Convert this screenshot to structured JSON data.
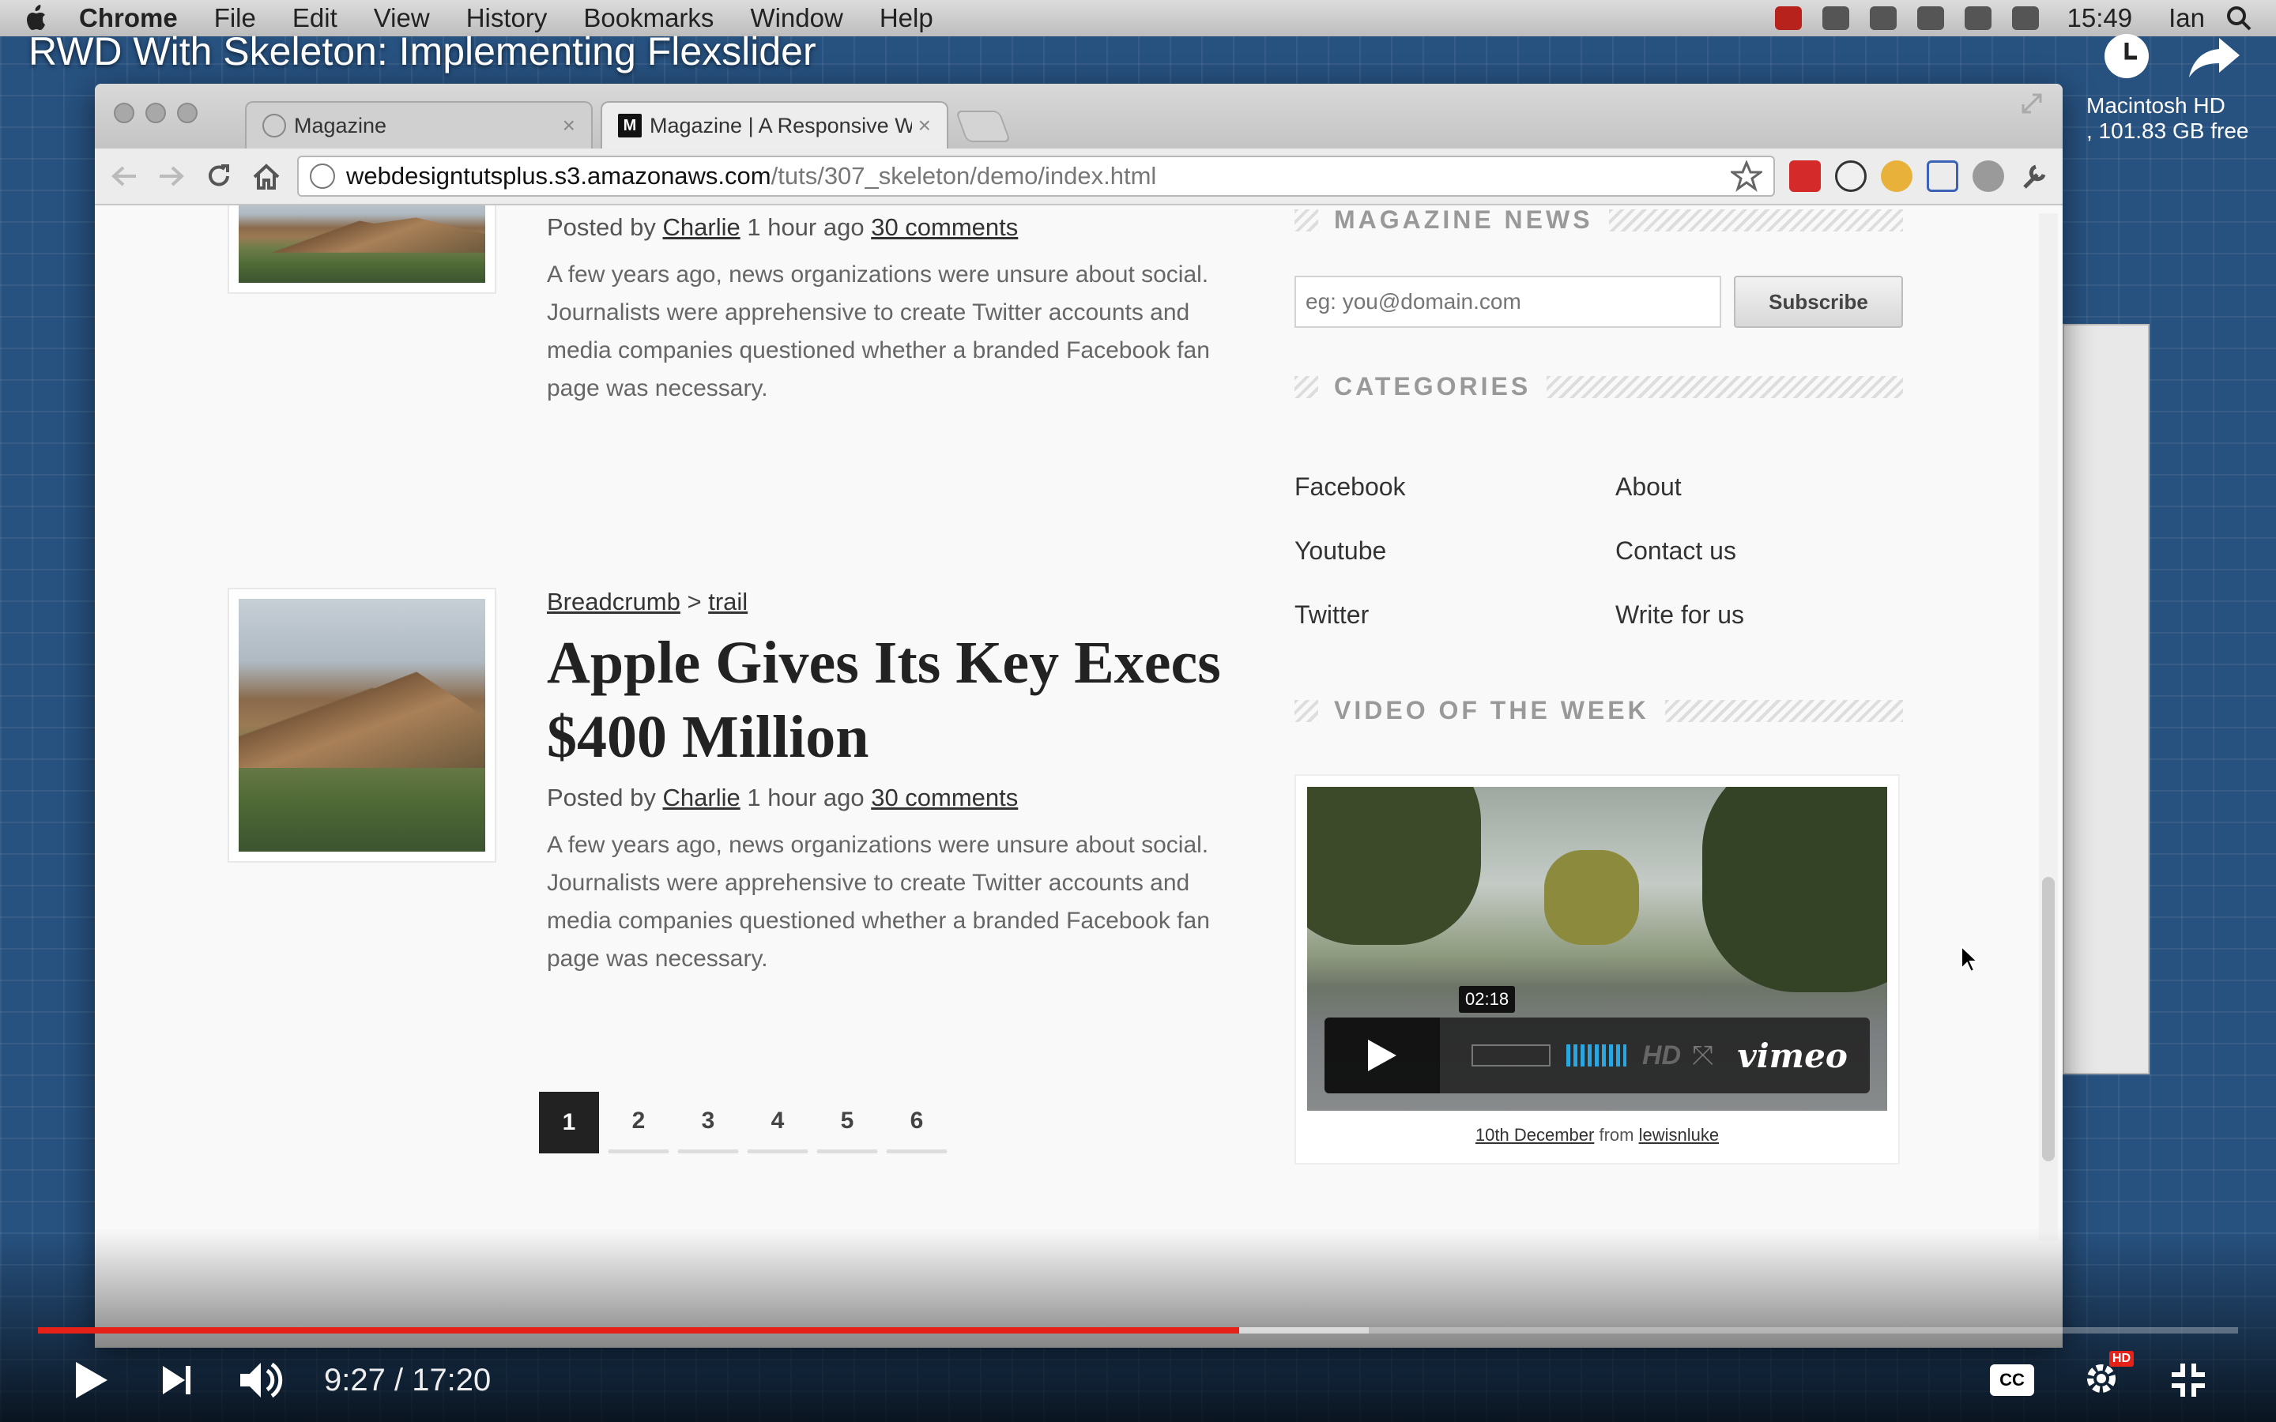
{
  "menubar": {
    "app": "Chrome",
    "items": [
      "File",
      "Edit",
      "View",
      "History",
      "Bookmarks",
      "Window",
      "Help"
    ],
    "clock": "15:49",
    "user": "Ian"
  },
  "video": {
    "title": "RWD With Skeleton: Implementing Flexslider",
    "current_time": "9:27",
    "duration": "17:20",
    "time_display": "9:27 / 17:20",
    "played_fraction": 0.546,
    "buffered_fraction": 0.605,
    "cc_label": "CC",
    "hd_label": "HD"
  },
  "desktop": {
    "disk_label": "Macintosh HD",
    "disk_free": ", 101.83 GB free"
  },
  "browser": {
    "tabs": [
      {
        "label": "Magazine"
      },
      {
        "label": "Magazine | A Responsive We"
      }
    ],
    "url_host": "webdesigntutsplus.s3.amazonaws.com",
    "url_path": "/tuts/307_skeleton/demo/index.html"
  },
  "articles": [
    {
      "meta_prefix": "Posted by",
      "author": "Charlie",
      "time": "1 hour ago",
      "comments": "30 comments",
      "excerpt": "A few years ago, news organizations were unsure about social. Journalists were apprehensive to create Twitter accounts and media companies questioned whether a branded Facebook fan page was necessary."
    },
    {
      "crumb1": "Breadcrumb",
      "crumb_sep": ">",
      "crumb2": "trail",
      "headline": "Apple Gives Its Key Execs $400 Million",
      "meta_prefix": "Posted by",
      "author": "Charlie",
      "time": "1 hour ago",
      "comments": "30 comments",
      "excerpt": "A few years ago, news organizations were unsure about social. Journalists were apprehensive to create Twitter accounts and media companies questioned whether a branded Facebook fan page was necessary."
    }
  ],
  "pagination": {
    "pages": [
      "1",
      "2",
      "3",
      "4",
      "5",
      "6"
    ],
    "active": "1"
  },
  "sidebar": {
    "news_title": "MAGAZINE NEWS",
    "email_placeholder": "eg: you@domain.com",
    "subscribe_label": "Subscribe",
    "categories_title": "CATEGORIES",
    "categories": [
      "Facebook",
      "About",
      "Youtube",
      "Contact us",
      "Twitter",
      "Write for us"
    ],
    "video_title": "VIDEO OF THE WEEK",
    "video_time": "02:18",
    "video_hd": "HD",
    "video_brand": "vimeo",
    "video_caption_link": "10th December",
    "video_caption_from": "from",
    "video_caption_user": "lewisnluke"
  }
}
